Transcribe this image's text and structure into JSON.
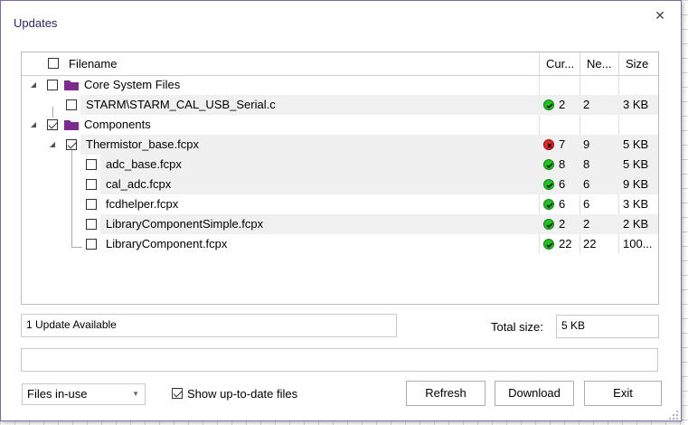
{
  "window": {
    "title": "Updates"
  },
  "columns": {
    "filename": "Filename",
    "current": "Cur...",
    "new": "Ne...",
    "size": "Size"
  },
  "rows": [
    {
      "name": "Core System Files",
      "kind": "folder",
      "current": "",
      "new": "",
      "size": "",
      "checked": false,
      "status": ""
    },
    {
      "name": "STARM\\STARM_CAL_USB_Serial.c",
      "kind": "file",
      "current": "2",
      "new": "2",
      "size": "3 KB",
      "checked": false,
      "status": "ok"
    },
    {
      "name": "Components",
      "kind": "folder",
      "current": "",
      "new": "",
      "size": "",
      "checked": true,
      "status": ""
    },
    {
      "name": "Thermistor_base.fcpx",
      "kind": "file",
      "current": "7",
      "new": "9",
      "size": "5 KB",
      "checked": true,
      "status": "bad"
    },
    {
      "name": "adc_base.fcpx",
      "kind": "file",
      "current": "8",
      "new": "8",
      "size": "5 KB",
      "checked": false,
      "status": "ok"
    },
    {
      "name": "cal_adc.fcpx",
      "kind": "file",
      "current": "6",
      "new": "6",
      "size": "9 KB",
      "checked": false,
      "status": "ok"
    },
    {
      "name": "fcdhelper.fcpx",
      "kind": "file",
      "current": "6",
      "new": "6",
      "size": "3 KB",
      "checked": false,
      "status": "ok"
    },
    {
      "name": "LibraryComponentSimple.fcpx",
      "kind": "file",
      "current": "2",
      "new": "2",
      "size": "2 KB",
      "checked": false,
      "status": "ok"
    },
    {
      "name": "LibraryComponent.fcpx",
      "kind": "file",
      "current": "22",
      "new": "22",
      "size": "100...",
      "checked": false,
      "status": "ok"
    }
  ],
  "summary": {
    "updates_available": "1 Update Available",
    "total_size_label": "Total size:",
    "total_size_value": "5 KB"
  },
  "progress_text": "",
  "filter": {
    "selected": "Files in-use"
  },
  "show_uptodate": {
    "label": "Show up-to-date files",
    "checked": true
  },
  "buttons": {
    "refresh": "Refresh",
    "download": "Download",
    "exit": "Exit"
  },
  "colors": {
    "folder": "#7b2a8e",
    "ok": "#22c022",
    "bad": "#e02828",
    "title": "#2a2560"
  }
}
